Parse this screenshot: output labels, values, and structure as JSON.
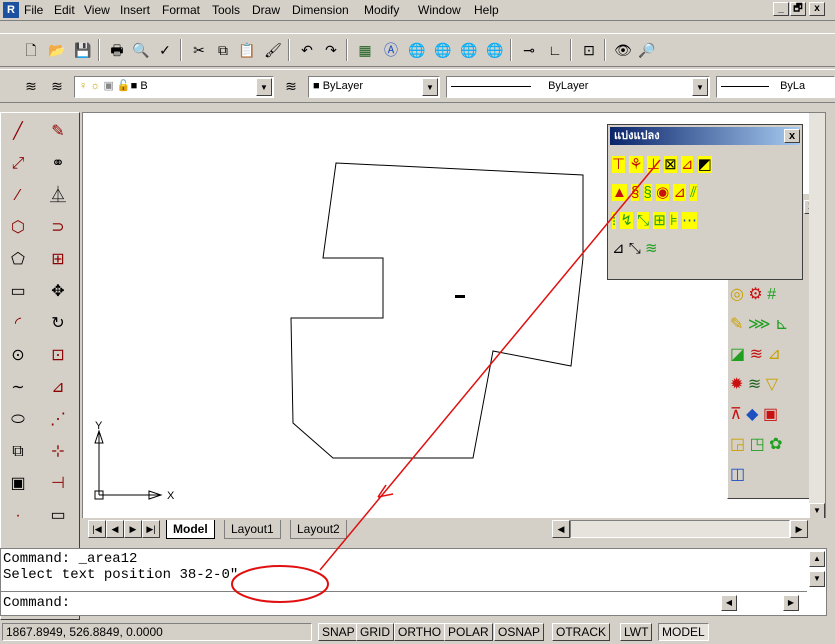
{
  "menu": {
    "items": [
      "File",
      "Edit",
      "View",
      "Insert",
      "Format",
      "Tools",
      "Draw",
      "Dimension",
      "Modify",
      "Window",
      "Help"
    ]
  },
  "window_controls": {
    "minimize": "_",
    "restore": "🗗",
    "close": "x"
  },
  "layers": {
    "layer_value": "B",
    "color_value": "ByLayer",
    "linetype_value": "ByLayer",
    "lineweight_value": "ByLa"
  },
  "floating_toolbar": {
    "title": "แบ่งแปลง",
    "close": "x"
  },
  "tabs": [
    "Model",
    "Layout1",
    "Layout2"
  ],
  "ucs": {
    "x_label": "X",
    "y_label": "Y"
  },
  "command": {
    "line1": "Command: _area12",
    "line2_prefix": "Select text position",
    "line2_value": "38-2-0\"",
    "line3": "Command:"
  },
  "status": {
    "coordinates": "1867.8949, 526.8849, 0.0000",
    "toggles": [
      "SNAP",
      "GRID",
      "ORTHO",
      "POLAR",
      "OSNAP",
      "OTRACK",
      "LWT",
      "MODEL"
    ]
  },
  "colors": {
    "annotation_red": "#e01010",
    "title_bar": "#0a246a"
  }
}
